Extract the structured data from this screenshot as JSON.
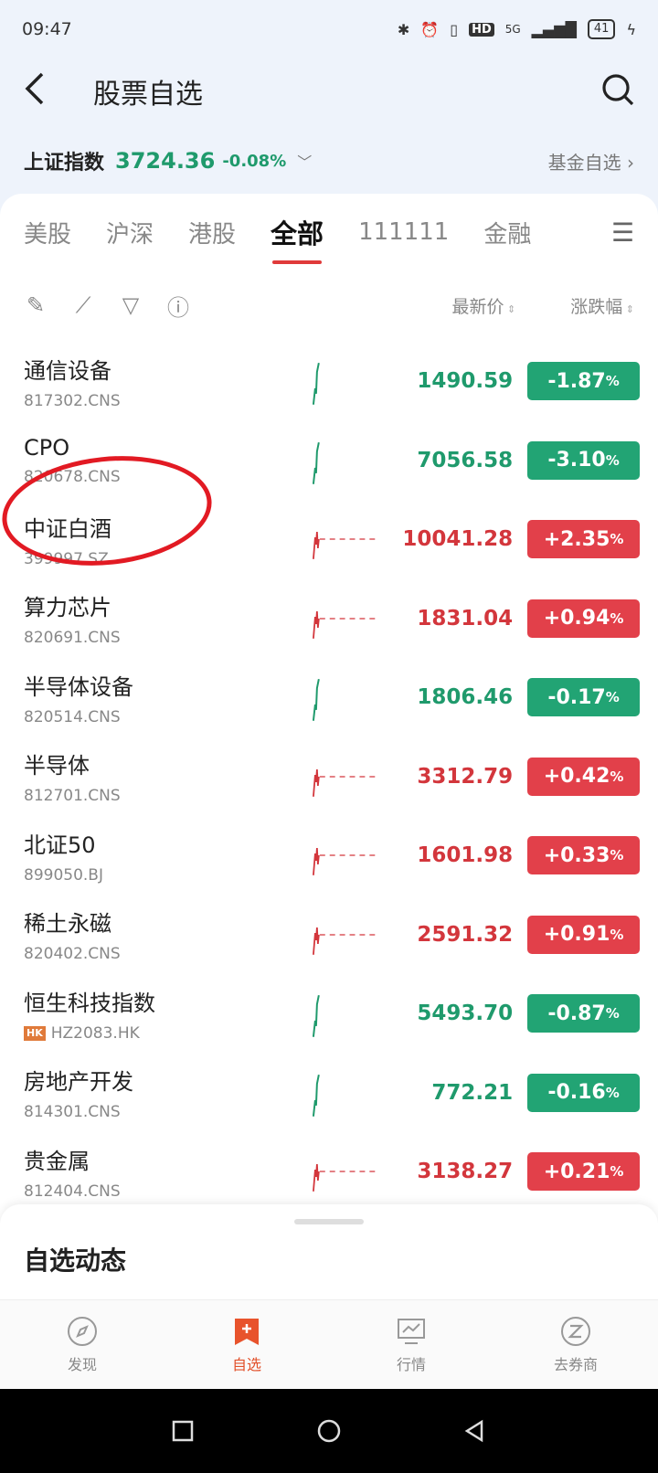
{
  "status": {
    "time": "09:47",
    "battery": "41",
    "network": "5G",
    "hd": "HD"
  },
  "header": {
    "title": "股票自选",
    "back_icon": "back-arrow-icon",
    "search_icon": "search-icon"
  },
  "index": {
    "name": "上证指数",
    "value": "3724.36",
    "change": "-0.08%",
    "fund_link": "基金自选"
  },
  "tabs": [
    {
      "label": "美股",
      "active": false
    },
    {
      "label": "沪深",
      "active": false
    },
    {
      "label": "港股",
      "active": false
    },
    {
      "label": "全部",
      "active": true
    },
    {
      "label": "111111",
      "active": false
    },
    {
      "label": "金融",
      "active": false
    }
  ],
  "toolbar": {
    "price_label": "最新价",
    "change_label": "涨跌幅"
  },
  "stocks": [
    {
      "name": "通信设备",
      "code": "817302.CNS",
      "price": "1490.59",
      "change": "-1.87",
      "dir": "down"
    },
    {
      "name": "CPO",
      "code": "820678.CNS",
      "price": "7056.58",
      "change": "-3.10",
      "dir": "down"
    },
    {
      "name": "中证白酒",
      "code": "399997.SZ",
      "price": "10041.28",
      "change": "+2.35",
      "dir": "up"
    },
    {
      "name": "算力芯片",
      "code": "820691.CNS",
      "price": "1831.04",
      "change": "+0.94",
      "dir": "up"
    },
    {
      "name": "半导体设备",
      "code": "820514.CNS",
      "price": "1806.46",
      "change": "-0.17",
      "dir": "down"
    },
    {
      "name": "半导体",
      "code": "812701.CNS",
      "price": "3312.79",
      "change": "+0.42",
      "dir": "up"
    },
    {
      "name": "北证50",
      "code": "899050.BJ",
      "price": "1601.98",
      "change": "+0.33",
      "dir": "up"
    },
    {
      "name": "稀土永磁",
      "code": "820402.CNS",
      "price": "2591.32",
      "change": "+0.91",
      "dir": "up"
    },
    {
      "name": "恒生科技指数",
      "code": "HZ2083.HK",
      "price": "5493.70",
      "change": "-0.87",
      "dir": "down",
      "badge": "HK"
    },
    {
      "name": "房地产开发",
      "code": "814301.CNS",
      "price": "772.21",
      "change": "-0.16",
      "dir": "down"
    },
    {
      "name": "贵金属",
      "code": "812404.CNS",
      "price": "3138.27",
      "change": "+0.21",
      "dir": "up"
    }
  ],
  "percent_sign": "%",
  "dynamics": {
    "title": "自选动态"
  },
  "nav": [
    {
      "label": "发现",
      "icon": "compass-icon",
      "active": false
    },
    {
      "label": "自选",
      "icon": "watchlist-add-icon",
      "active": true
    },
    {
      "label": "行情",
      "icon": "market-chart-icon",
      "active": false
    },
    {
      "label": "去券商",
      "icon": "broker-icon",
      "active": false
    }
  ]
}
